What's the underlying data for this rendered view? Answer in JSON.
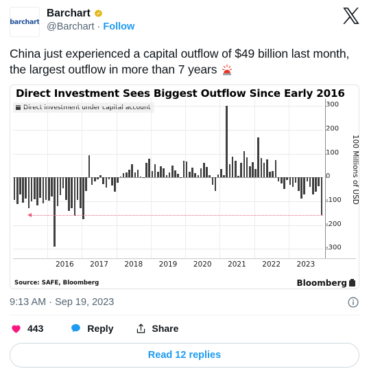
{
  "header": {
    "avatar_text": "barchart",
    "display_name": "Barchart",
    "verified_icon": "verified-badge-gold",
    "handle": "@Barchart",
    "separator": "·",
    "follow_label": "Follow",
    "close_icon": "x-logo-icon"
  },
  "tweet": {
    "text": "China just experienced a capital outflow of $49 billion last month, the largest outflow in more than 7 years ",
    "emoji": "rotating-light-emoji"
  },
  "meta": {
    "timestamp": "9:13 AM · Sep 19, 2023",
    "info_icon": "info-circle-icon"
  },
  "actions": {
    "like_icon": "heart-icon",
    "like_count": "443",
    "reply_icon": "comment-bubble-icon",
    "reply_label": "Reply",
    "share_icon": "share-arrow-icon",
    "share_label": "Share"
  },
  "footer": {
    "read_replies_label": "Read 12 replies"
  },
  "colors": {
    "accent_blue": "#1d9bf0",
    "like_pink": "#f91880",
    "reply_blue": "#1d9bf0",
    "bar_gray": "#3f3f3f",
    "annotation_red": "#e8607e",
    "verified_gold": "#e2b719"
  },
  "chart_data": {
    "type": "bar",
    "title": "Direct Investment Sees Biggest Outflow Since Early 2016",
    "legend": [
      "Direct investment under capital account"
    ],
    "legend_position": "top-left",
    "ylabel": "100 Millions of USD",
    "xlabel": "",
    "ylim": [
      -340,
      330
    ],
    "ytick_labels": [
      "300",
      "200",
      "100",
      "0",
      "-100",
      "-200",
      "-300"
    ],
    "ytick_values": [
      300,
      200,
      100,
      0,
      -100,
      -200,
      -300
    ],
    "xtick_labels": [
      "2016",
      "2017",
      "2018",
      "2019",
      "2020",
      "2021",
      "2022",
      "2023"
    ],
    "grid": true,
    "source": "Source: SAFE, Bloomberg",
    "brand": "Bloomberg",
    "annotation": {
      "type": "horizontal-dotted-arrow",
      "value": -158,
      "label": ""
    },
    "x_start_index_of_2016": 12,
    "months_per_year": 12,
    "values": [
      -95,
      -112,
      -70,
      -105,
      -88,
      -130,
      -100,
      -92,
      -118,
      -85,
      -108,
      -95,
      -98,
      -80,
      -290,
      -120,
      -75,
      -45,
      -95,
      -140,
      -130,
      -160,
      -95,
      -128,
      -175,
      -58,
      92,
      -30,
      -18,
      -8,
      8,
      -28,
      -42,
      -8,
      -35,
      -60,
      -22,
      5,
      18,
      22,
      32,
      55,
      20,
      32,
      5,
      1,
      62,
      78,
      28,
      55,
      25,
      48,
      38,
      8,
      20,
      50,
      30,
      15,
      2,
      70,
      68,
      25,
      40,
      18,
      10,
      38,
      62,
      45,
      8,
      -32,
      -58,
      12,
      36,
      10,
      300,
      55,
      88,
      70,
      6,
      62,
      110,
      85,
      48,
      65,
      35,
      168,
      82,
      60,
      75,
      25,
      28,
      72,
      -18,
      -25,
      -48,
      -10,
      -32,
      -40,
      -22,
      -58,
      -90,
      -72,
      -18,
      -40,
      -72,
      -60,
      -38,
      -158
    ]
  }
}
